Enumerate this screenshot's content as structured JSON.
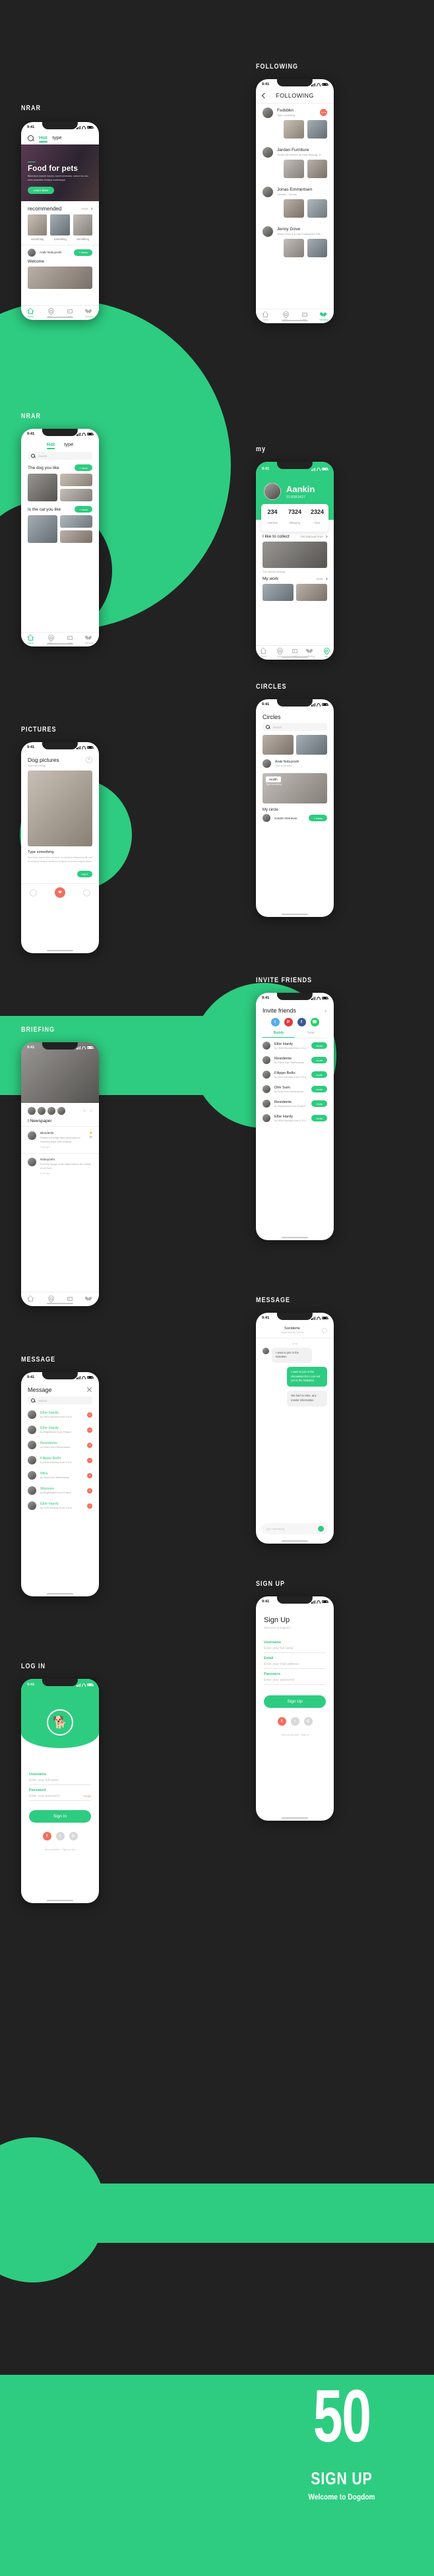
{
  "meta": {
    "accent": "#2ECC80",
    "background": "#222222",
    "coral": "#F2705E",
    "status_time": "9:41"
  },
  "sections": [
    {
      "caption": "NRAR"
    },
    {
      "caption": "FOLLOWING"
    },
    {
      "caption": "NRAR"
    },
    {
      "caption": "my"
    },
    {
      "caption": "PICTURES"
    },
    {
      "caption": "CIRCLES"
    },
    {
      "caption": "BRIEFING"
    },
    {
      "caption": "INVITE FRIENDS"
    },
    {
      "caption": "MESSAGE"
    },
    {
      "caption": "MESSAGE"
    },
    {
      "caption": "LOG IN"
    },
    {
      "caption": "SIGN UP"
    }
  ],
  "home": {
    "tabs": [
      {
        "label": "Hot",
        "active": true
      },
      {
        "label": "type",
        "active": false
      }
    ],
    "search_placeholder": "Search",
    "hero": {
      "title": "Food for pets",
      "body": "Bibendum blandit mauris, morbi venenatis, rutrum leo nec enim phasellus tristique scelerisque.",
      "cta": "Learn More"
    },
    "recommended": {
      "title": "recommended",
      "more": "more",
      "cards": [
        {
          "caption": "something"
        },
        {
          "caption": "something"
        },
        {
          "caption": "something"
        }
      ]
    },
    "welcome": {
      "name": "Araki Nobuyoshi",
      "follow": "+ follow",
      "title": "Welcome"
    },
    "tabbar": [
      {
        "label": "home",
        "icon": "home-icon",
        "active": true
      },
      {
        "label": "near",
        "icon": "pin-icon",
        "active": false
      },
      {
        "label": "mail",
        "icon": "mail-icon",
        "active": false
      },
      {
        "label": "following",
        "icon": "heart-icon",
        "active": false
      }
    ]
  },
  "following": {
    "title": "FOLLOWING",
    "back": "back-icon",
    "people": [
      {
        "name": "Fsdsbkn",
        "sub": "Type something"
      },
      {
        "name": "Jardan Furniture",
        "sub": "Senior Art Director @ Hello Monday, New York"
      },
      {
        "name": "Jonas Emmertsen",
        "sub": "Canada - Toronto"
      },
      {
        "name": "Jenny Gove",
        "sub": "Jenny Gove is a User Experience Researcher"
      }
    ],
    "tabbar": [
      {
        "label": "home",
        "icon": "home-icon",
        "active": false
      },
      {
        "label": "near",
        "icon": "pin-icon",
        "active": false
      },
      {
        "label": "mail",
        "icon": "mail-icon",
        "active": false
      },
      {
        "label": "following",
        "icon": "heart-icon",
        "active": true
      }
    ]
  },
  "nrar2": {
    "tabs": [
      {
        "label": "Hot",
        "active": true
      },
      {
        "label": "type",
        "active": false
      }
    ],
    "search_placeholder": "Search",
    "groups": [
      {
        "title": "The dog you like",
        "more": "+ more"
      },
      {
        "title": "Is the cat you like",
        "more": "+ more"
      }
    ],
    "tabbar": [
      {
        "label": "home",
        "icon": "home-icon",
        "active": true
      },
      {
        "label": "near",
        "icon": "pin-icon",
        "active": false
      },
      {
        "label": "mail",
        "icon": "mail-icon",
        "active": false
      },
      {
        "label": "following",
        "icon": "heart-icon",
        "active": false
      }
    ]
  },
  "profile": {
    "name": "Aankin",
    "id": "ID:8383427",
    "stats": [
      {
        "value": "234",
        "label": "Attention"
      },
      {
        "value": "7324",
        "label": "following"
      },
      {
        "value": "2324",
        "label": "fans"
      }
    ],
    "collect": {
      "title": "I like to collect",
      "more": "Get Manual Free"
    },
    "collect_caption": "The sweets findings",
    "work": {
      "title": "My work",
      "more": "more"
    },
    "tabbar": [
      {
        "label": "home",
        "icon": "home-icon",
        "active": false
      },
      {
        "label": "near",
        "icon": "pin-icon",
        "active": false
      },
      {
        "label": "mail",
        "icon": "mail-icon",
        "active": false
      },
      {
        "label": "following",
        "icon": "heart-icon",
        "active": false
      },
      {
        "label": "my",
        "icon": "user-icon",
        "active": true
      }
    ]
  },
  "pictures": {
    "title": "Dog pictures",
    "subtitle": "Type something",
    "add": "+",
    "comment_title": "Type something",
    "comment_body": "Sea lorem ipsum dolor sit amet, consectetur adipiscing elit, sed do eiusmod tempor incididunt ut labore et dolore magna aliqua.",
    "cta": "say it",
    "actions": [
      "share-icon",
      "heart-icon",
      "more-icon"
    ]
  },
  "circles": {
    "title": "Circles",
    "search_placeholder": "Search",
    "user": {
      "name": "Araki Nobuyoshi",
      "sub": "Type something"
    },
    "health": {
      "label": "Health",
      "sub": "Type something"
    },
    "mycircle": {
      "title": "My circle",
      "item": "Golden Retriever",
      "cta": "+ follow"
    }
  },
  "briefing": {
    "title": "I Newspaper",
    "posts": [
      {
        "name": "Blonderile",
        "body": "Restaurant bridge takes great pains to choosing anger after crawling",
        "time": "4 min ago"
      },
      {
        "name": "Nobuyoshi",
        "body": "From the design of the object itself to the variety of our lives",
        "time": "8 min ago"
      }
    ],
    "likes": "24",
    "comments": "12"
  },
  "invite": {
    "title": "Invite friends",
    "add": "+",
    "socials": [
      "twitter",
      "pinterest",
      "facebook",
      "whatsapp"
    ],
    "tabs": [
      {
        "label": "Buddy",
        "active": true
      },
      {
        "label": "Near",
        "active": false
      }
    ],
    "friends": [
      {
        "name": "Ellie Hardy",
        "sub": "by Hello Monday from U.S.A.",
        "action": "Invite"
      },
      {
        "name": "Residente",
        "sub": "by Risen from Netherlands",
        "action": "Invite"
      },
      {
        "name": "Filippo Bello",
        "sub": "by Hello Monday from U.S.A.",
        "action": "Invite"
      },
      {
        "name": "Dlm Sum",
        "sub": "by Ryan from Netherlands",
        "action": "Invite"
      },
      {
        "name": "Residente",
        "sub": "by Brightfolans from Poland",
        "action": "Invite"
      },
      {
        "name": "Ellie Hardy",
        "sub": "by Hello Monday from U.S.A.",
        "action": "Invite"
      }
    ]
  },
  "message_list": {
    "title": "Message",
    "search_placeholder": "Search",
    "items": [
      {
        "name": "Ellie Hardy",
        "sub": "by Hello Monday from U.S.A.",
        "badge": "2"
      },
      {
        "name": "Ellie Hardy",
        "sub": "by Brightfolans from Poland",
        "badge": "1"
      },
      {
        "name": "Residente",
        "sub": "by Risen from Netherlands",
        "badge": "3"
      },
      {
        "name": "Filippo Bello",
        "sub": "by Hello Monday from U.S.A.",
        "badge": "1"
      },
      {
        "name": "Mira",
        "sub": "by Ryan from Netherlands",
        "badge": "5"
      },
      {
        "name": "Warsaw",
        "sub": "by Brightfolans from Poland",
        "badge": "2"
      },
      {
        "name": "Ellie Hardy",
        "sub": "by Hello Monday from U.S.A.",
        "badge": "1"
      }
    ]
  },
  "chat": {
    "name": "Sociderte",
    "status": "Filippo\nViewing 2:22 PM",
    "day": "Today",
    "messages": [
      {
        "from": "you",
        "text": "I want to join in the invitation"
      },
      {
        "from": "me",
        "text": "I want to join in the discussion but I can not yet to the invitation"
      },
      {
        "from": "you",
        "text": "We had no idea, any insider information"
      }
    ],
    "input_placeholder": "Type something"
  },
  "login": {
    "fields": [
      {
        "label": "Username",
        "placeholder": "Enter your full name"
      },
      {
        "label": "Password",
        "placeholder": "Enter your password"
      }
    ],
    "forgot": "Forgot",
    "submit": "Sign In",
    "socials": [
      "facebook",
      "twitter",
      "google"
    ],
    "footer": "Not a member ? Sign up now"
  },
  "signup": {
    "title": "Sign Up",
    "subtitle": "Welcome to Dogdom",
    "fields": [
      {
        "label": "Username",
        "placeholder": "Enter your full name"
      },
      {
        "label": "Email",
        "placeholder": "Enter your mail address"
      },
      {
        "label": "Passwors",
        "placeholder": "Enter your password"
      }
    ],
    "submit": "Sign  Up",
    "socials": [
      "facebook",
      "twitter",
      "google"
    ],
    "footer": "Have an account ? Sign In"
  },
  "footer": {
    "number": "50",
    "title": "SIGN  UP",
    "subtitle": "Welcome to Dogdom"
  }
}
